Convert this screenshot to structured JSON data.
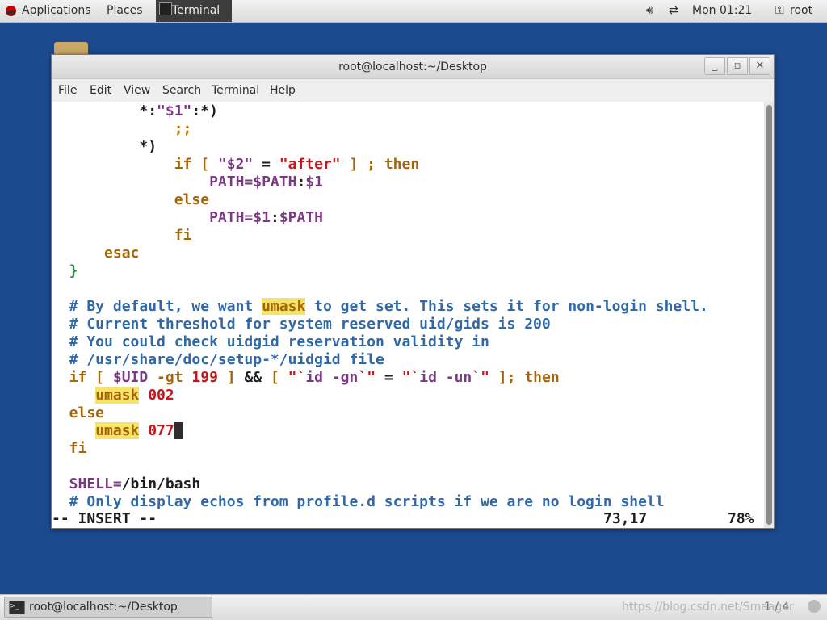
{
  "topbar": {
    "applications": "Applications",
    "places": "Places",
    "terminal_task": "Terminal",
    "clock": "Mon 01:21",
    "user": "root"
  },
  "window": {
    "title": "root@localhost:~/Desktop",
    "menu": [
      "File",
      "Edit",
      "View",
      "Search",
      "Terminal",
      "Help"
    ]
  },
  "editor": {
    "lines": [
      [
        [
          "",
          "pad"
        ],
        [
          "          *:",
          "t"
        ],
        [
          "\"$1\"",
          "p"
        ],
        [
          ":*)",
          "t"
        ]
      ],
      [
        [
          "              ;;",
          "o"
        ]
      ],
      [
        [
          "          *)",
          "t"
        ]
      ],
      [
        [
          "              if [ ",
          "k"
        ],
        [
          "\"$2\"",
          "p"
        ],
        [
          " = ",
          "t"
        ],
        [
          "\"after\"",
          "s"
        ],
        [
          " ] ; then",
          "k"
        ]
      ],
      [
        [
          "                  PATH=",
          "p"
        ],
        [
          "$PATH",
          "p"
        ],
        [
          ":",
          "t"
        ],
        [
          "$1",
          "p"
        ]
      ],
      [
        [
          "              else",
          "k"
        ]
      ],
      [
        [
          "                  PATH=",
          "p"
        ],
        [
          "$1",
          "p"
        ],
        [
          ":",
          "t"
        ],
        [
          "$PATH",
          "p"
        ]
      ],
      [
        [
          "              fi",
          "k"
        ]
      ],
      [
        [
          "      esac",
          "k"
        ]
      ],
      [
        [
          "  }",
          "g"
        ]
      ],
      [
        [
          "",
          "t"
        ]
      ],
      [
        [
          "  # By default, we want ",
          "m"
        ],
        [
          "umask",
          "hl"
        ],
        [
          " to get set. This sets it for non-login shell.",
          "m"
        ]
      ],
      [
        [
          "  # Current threshold for system reserved uid/gids is 200",
          "m"
        ]
      ],
      [
        [
          "  # You could check uidgid reservation validity in",
          "m"
        ]
      ],
      [
        [
          "  # /usr/share/doc/setup-*/uidgid file",
          "m"
        ]
      ],
      [
        [
          "  if [ ",
          "k"
        ],
        [
          "$UID",
          "p"
        ],
        [
          " -gt ",
          "k"
        ],
        [
          "199",
          "n"
        ],
        [
          " ] ",
          "k"
        ],
        [
          "&&",
          "t"
        ],
        [
          " [ ",
          "k"
        ],
        [
          "\"`",
          "s"
        ],
        [
          "id -gn",
          "p"
        ],
        [
          "`\"",
          "s"
        ],
        [
          " = ",
          "t"
        ],
        [
          "\"`",
          "s"
        ],
        [
          "id -un",
          "p"
        ],
        [
          "`\"",
          "s"
        ],
        [
          " ]; then",
          "k"
        ]
      ],
      [
        [
          "     ",
          "t"
        ],
        [
          "umask",
          "hl"
        ],
        [
          " ",
          "t"
        ],
        [
          "002",
          "n"
        ]
      ],
      [
        [
          "  else",
          "k"
        ]
      ],
      [
        [
          "     ",
          "t"
        ],
        [
          "umask",
          "hl"
        ],
        [
          " ",
          "t"
        ],
        [
          "077",
          "n"
        ],
        [
          "",
          "cur"
        ]
      ],
      [
        [
          "  fi",
          "k"
        ]
      ],
      [
        [
          "",
          "t"
        ]
      ],
      [
        [
          "  SHELL=",
          "p"
        ],
        [
          "/bin/bash",
          "t"
        ]
      ],
      [
        [
          "  # Only display echos from profile.d scripts if we are no login shell",
          "m"
        ]
      ]
    ],
    "status_mode": "-- INSERT --",
    "status_pos": "73,17",
    "status_pct": "78%"
  },
  "taskbar": {
    "task_label": "root@localhost:~/Desktop",
    "watermark": "https://blog.csdn.net/Smaager",
    "pager": "1 / 4"
  }
}
